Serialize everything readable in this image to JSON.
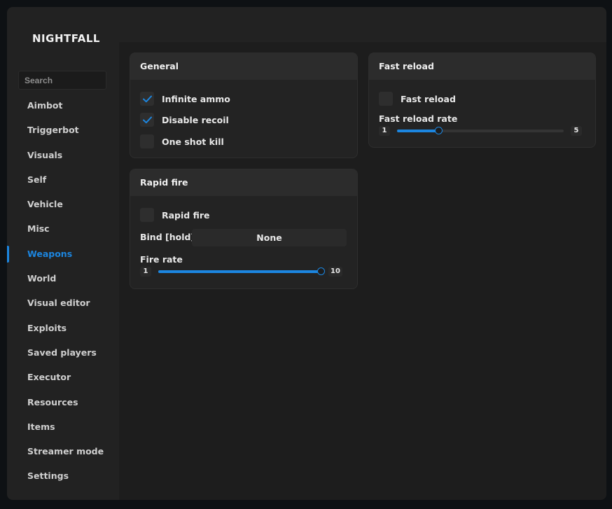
{
  "app": {
    "title": "NIGHTFALL"
  },
  "search": {
    "placeholder": "Search"
  },
  "sidebar": {
    "items": [
      {
        "label": "Aimbot"
      },
      {
        "label": "Triggerbot"
      },
      {
        "label": "Visuals"
      },
      {
        "label": "Self"
      },
      {
        "label": "Vehicle"
      },
      {
        "label": "Misc"
      },
      {
        "label": "Weapons",
        "active": true
      },
      {
        "label": "World"
      },
      {
        "label": "Visual editor"
      },
      {
        "label": "Exploits"
      },
      {
        "label": "Saved players"
      },
      {
        "label": "Executor"
      },
      {
        "label": "Resources"
      },
      {
        "label": "Items"
      },
      {
        "label": "Streamer mode"
      },
      {
        "label": "Settings"
      }
    ]
  },
  "panels": {
    "general": {
      "title": "General",
      "options": [
        {
          "label": "Infinite ammo",
          "checked": true
        },
        {
          "label": "Disable recoil",
          "checked": true
        },
        {
          "label": "One shot kill",
          "checked": false
        }
      ]
    },
    "rapid_fire": {
      "title": "Rapid fire",
      "toggle": {
        "label": "Rapid fire",
        "checked": false
      },
      "bind": {
        "label": "Bind [hold]",
        "value": "None"
      },
      "fire_rate": {
        "label": "Fire rate",
        "min": "1",
        "max": "10",
        "value": 10
      }
    },
    "fast_reload": {
      "title": "Fast reload",
      "toggle": {
        "label": "Fast reload",
        "checked": false
      },
      "rate": {
        "label": "Fast reload rate",
        "min": "1",
        "max": "5",
        "value": 2
      }
    }
  },
  "colors": {
    "accent": "#1c86e0",
    "window_bg": "#222222",
    "panel_bg": "#232323",
    "panel_header_bg": "#2c2c2c"
  }
}
